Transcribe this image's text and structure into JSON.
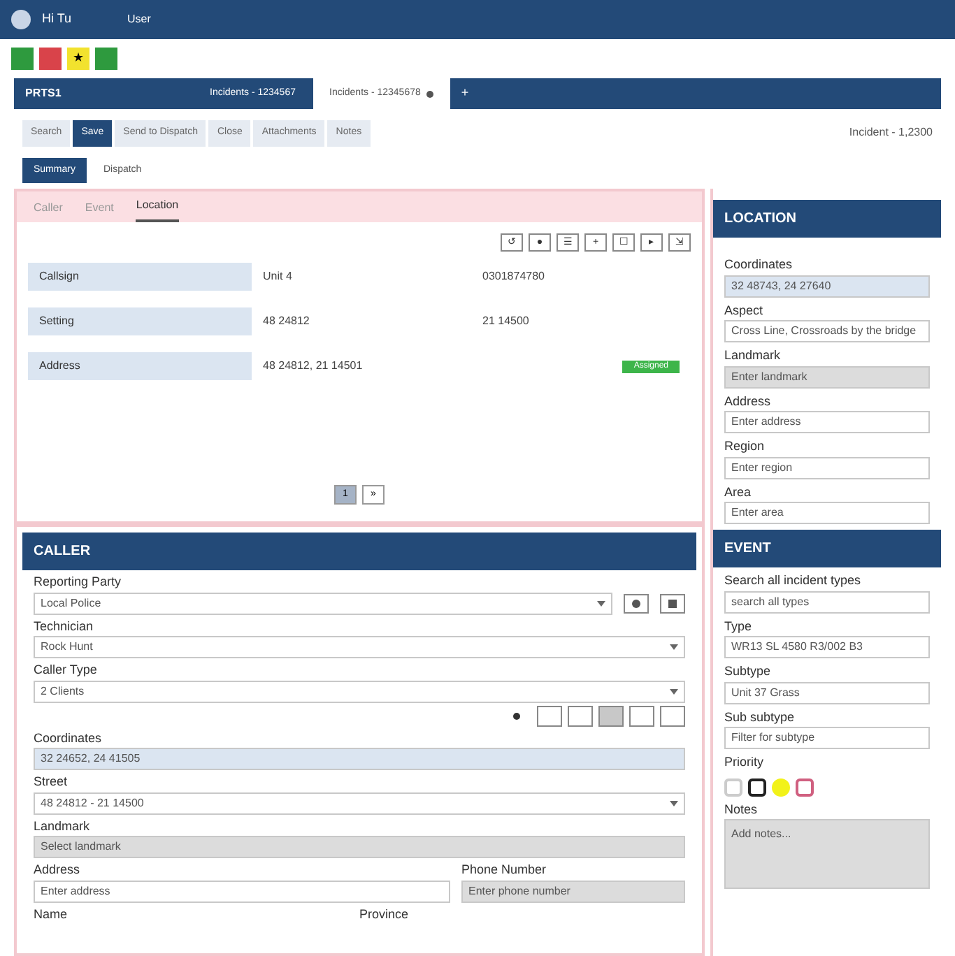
{
  "topbar": {
    "user": "Hi Tu",
    "menu": "User"
  },
  "quick_actions": [
    {
      "color": "#2e9a3e"
    },
    {
      "color": "#d9434a"
    },
    {
      "color": "#f2e22e",
      "glyph": "★"
    },
    {
      "color": "#2e9a3e"
    }
  ],
  "doc_tabs": {
    "label": "PRTS1",
    "tabs": [
      {
        "label": "Incidents - 1234567",
        "selected": false,
        "closable": false
      },
      {
        "label": "Incidents - 12345678",
        "selected": true,
        "closable": true
      }
    ],
    "add": "+"
  },
  "actions": [
    {
      "label": "Search",
      "selected": false
    },
    {
      "label": "Save",
      "selected": true
    },
    {
      "label": "Send to Dispatch",
      "selected": false
    },
    {
      "label": "Close",
      "selected": false
    },
    {
      "label": "Attachments",
      "selected": false
    },
    {
      "label": "Notes",
      "selected": false
    }
  ],
  "incident_ref": "Incident - 1,2300",
  "view_tabs": [
    {
      "label": "Summary",
      "selected": true
    },
    {
      "label": "Dispatch",
      "selected": false
    }
  ],
  "record_tabs": [
    {
      "label": "Caller",
      "selected": false
    },
    {
      "label": "Event",
      "selected": false
    },
    {
      "label": "Location",
      "selected": true
    }
  ],
  "tool_buttons": [
    "↺",
    "●",
    "☰",
    "+",
    "☐",
    "▸",
    "⇲"
  ],
  "rows": [
    {
      "label": "Callsign",
      "value": "Unit 4",
      "value_2": "0301874780"
    },
    {
      "label": "Setting",
      "value": "48 24812",
      "value_2": "21 14500"
    },
    {
      "label": "Address",
      "value": "48 24812, 21 14501",
      "badge": "Assigned"
    }
  ],
  "pager": [
    {
      "label": "1",
      "selected": true
    },
    {
      "label": "»",
      "selected": false
    }
  ],
  "location": {
    "title": "LOCATION",
    "fields": [
      {
        "label": "Coordinates",
        "value": "32 48743, 24 27640",
        "kind": "highlight"
      },
      {
        "label": "Aspect",
        "value": "Cross Line, Crossroads by the bridge",
        "kind": "text"
      },
      {
        "label": "Landmark",
        "value": "Enter landmark",
        "kind": "disabled"
      },
      {
        "label": "Address",
        "value": "Enter address",
        "kind": "text"
      },
      {
        "label": "Region",
        "value": "Enter region",
        "kind": "text"
      },
      {
        "label": "Area",
        "value": "Enter area",
        "kind": "text"
      }
    ]
  },
  "caller": {
    "title": "CALLER",
    "reporting": {
      "label": "Reporting Party",
      "value": "Local Police"
    },
    "fields_a": [
      {
        "label": "Technician",
        "value": "Rock Hunt"
      },
      {
        "label": "Caller Type",
        "value": "2 Clients"
      }
    ],
    "coordinates": {
      "label": "Coordinates",
      "value": "32 24652, 24 41505"
    },
    "street": {
      "label": "Street",
      "value": "48 24812 - 21 14500"
    },
    "landmark": {
      "label": "Landmark",
      "value": "Select landmark"
    },
    "address": {
      "label": "Address",
      "value": "Enter address"
    },
    "phone": {
      "label": "Phone Number",
      "value": "Enter phone number"
    },
    "more": [
      "Name",
      "Province"
    ]
  },
  "event": {
    "title": "EVENT",
    "fields": [
      {
        "label": "Search all incident types",
        "value": "search all types"
      },
      {
        "label": "Type",
        "value": "WR13 SL 4580 R3/002 B3"
      },
      {
        "label": "Subtype",
        "value": "Unit 37 Grass"
      },
      {
        "label": "Sub subtype",
        "value": "Filter for subtype"
      }
    ],
    "priority_label": "Priority",
    "priorities": [
      {
        "color": "#ffffff",
        "selected": false
      },
      {
        "color": "#222222",
        "selected": false
      },
      {
        "color": "#f2f21a",
        "selected": true
      },
      {
        "color": "#d06080",
        "selected": false
      }
    ],
    "notes_label": "Notes",
    "notes": "Add notes..."
  }
}
